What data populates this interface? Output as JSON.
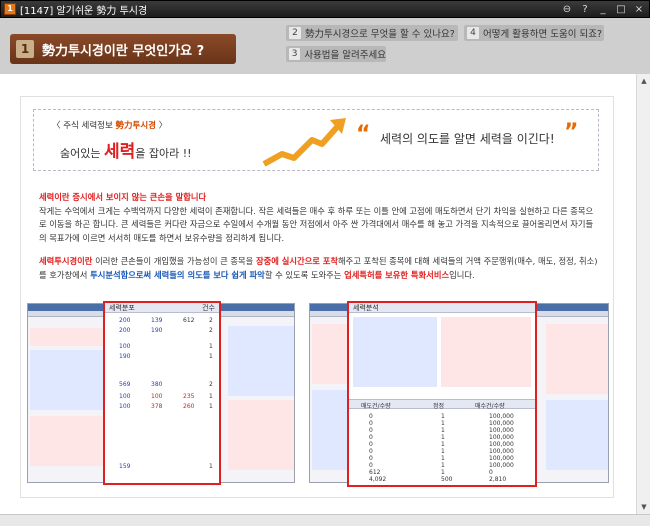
{
  "window": {
    "title": "[1147] 알기쉬운 勢力 투시경",
    "icon_label": "1"
  },
  "nav": {
    "current": {
      "number": "1",
      "label": "勢力투시경이란 무엇인가요 ?"
    },
    "topics": [
      {
        "number": "2",
        "label": "勢力투시경으로 무엇을 할 수 있나요?"
      },
      {
        "number": "3",
        "label": "사용법을 알려주세요"
      },
      {
        "number": "4",
        "label": "어떻게 활용하면 도움이 되죠?"
      }
    ]
  },
  "banner": {
    "sub_prefix": "〈 주식 세력정보 ",
    "sub_accent": "勢力투시경",
    "sub_suffix": " 〉",
    "slogan_prefix": "숨어있는 ",
    "slogan_big": "세력",
    "slogan_suffix": "을 잡아라 !!",
    "motto": "세력의 의도를 알면 세력을 이긴다!"
  },
  "sections": {
    "p1_head": "세력이란 증시에서 보이지 않는 큰손을 말합니다",
    "p1_body": "작게는 수억에서 크게는 수백억까지 다양한 세력이 존재합니다. 작은 세력들은 매수 후 하루 또는 이틀 안에 고점에 매도하면서 단기 차익을 실현하고 다른 종목으로 이동을 하곤 합니다. 큰 세력들은 커다란 자금으로 수일에서 수개월 동안 저점에서 아주 싼 가격대에서 매수를 해 놓고 가격을 지속적으로 끌어올리면서 자기들의 목표가에 이르면 서서히 매도를 하면서 보유수량을 정리하게 됩니다.",
    "p2_head": "세력투시경이란",
    "p2_a": " 이러한 큰손들이 개입했을 가능성이 큰 종목을 ",
    "p2_hl1": "장중에 실시간으로 포착",
    "p2_b": "해주고 포착된 종목에 대해 세력들의 거액 주문행위(매수, 매도, 정정, 취소)를 호가창에서 ",
    "p2_hl2": "투시분석함으로써 세력들의 의도를 보다 쉽게 파악",
    "p2_c": "할 수 있도록 도와주는 ",
    "p2_hl3": "업세특허를 보유한 특화서비스",
    "p2_d": "입니다."
  },
  "screens": {
    "left_focus_title": "세력분포",
    "left_focus_col": "건수",
    "left_rows": [
      {
        "a": "200",
        "b": "139",
        "c": "612",
        "d": "2"
      },
      {
        "a": "200",
        "b": "190",
        "c": "",
        "d": "2"
      },
      {
        "a": "100",
        "b": "",
        "c": "",
        "d": "1"
      },
      {
        "a": "190",
        "b": "",
        "c": "",
        "d": "1"
      },
      {
        "a": "569",
        "b": "380",
        "c": "",
        "d": "2"
      },
      {
        "a": "100",
        "b": "100",
        "c": "235",
        "d": "1"
      },
      {
        "a": "100",
        "b": "378",
        "c": "260",
        "d": "1"
      },
      {
        "a": "159",
        "b": "",
        "c": "",
        "d": "1"
      }
    ],
    "right_top_title": "세력분석",
    "right_bottom_cols": [
      "매도건/수량",
      "정정",
      "매수건/수량"
    ],
    "right_rows": [
      {
        "s": "0",
        "m": "1",
        "b": "100,000"
      },
      {
        "s": "0",
        "m": "1",
        "b": "100,000"
      },
      {
        "s": "0",
        "m": "1",
        "b": "100,000"
      },
      {
        "s": "0",
        "m": "1",
        "b": "100,000"
      },
      {
        "s": "0",
        "m": "1",
        "b": "100,000"
      },
      {
        "s": "0",
        "m": "1",
        "b": "100,000"
      },
      {
        "s": "0",
        "m": "1",
        "b": "100,000"
      },
      {
        "s": "0",
        "m": "1",
        "b": "100,000"
      },
      {
        "s": "612",
        "m": "1",
        "b": "0"
      },
      {
        "s": "4,092",
        "m": "500",
        "b": "2,810"
      }
    ]
  },
  "colors": {
    "accent_red": "#e02020",
    "accent_orange": "#e86a00",
    "nav_brown": "#7a3e20",
    "highlight_blue": "#1a5ab8"
  },
  "icons": {
    "arrow": "rising-arrow-icon",
    "close": "close-icon"
  }
}
